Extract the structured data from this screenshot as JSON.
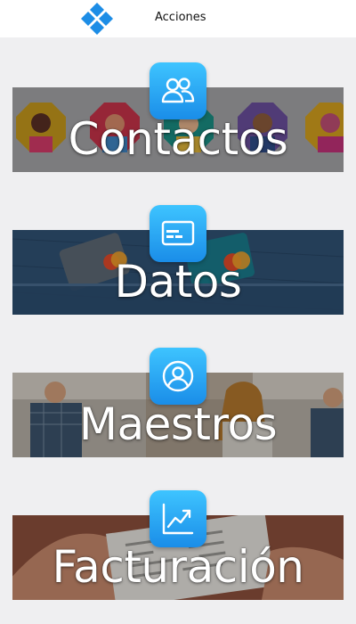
{
  "header": {
    "title": "Acciones",
    "logo_icon": "diamond-grid-icon"
  },
  "brand_color": "#1a8de8",
  "menu": [
    {
      "label": "Contactos",
      "icon": "people-icon"
    },
    {
      "label": "Datos",
      "icon": "card-icon"
    },
    {
      "label": "Maestros",
      "icon": "user-circle-icon"
    },
    {
      "label": "Facturación",
      "icon": "chart-trend-icon"
    }
  ]
}
